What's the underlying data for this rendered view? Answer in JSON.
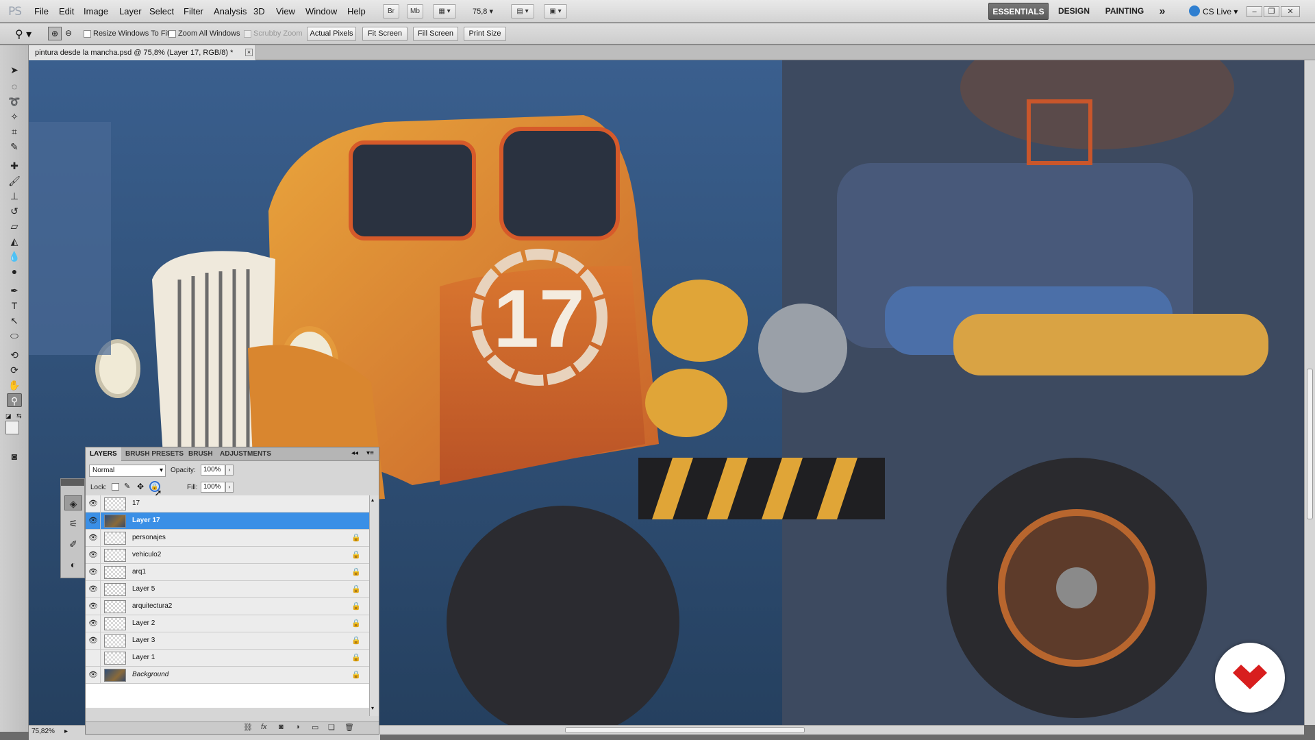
{
  "app": {
    "logo": "PS"
  },
  "menubar": {
    "items": [
      "File",
      "Edit",
      "Image",
      "Layer",
      "Select",
      "Filter",
      "Analysis",
      "3D",
      "View",
      "Window",
      "Help"
    ],
    "bridge_btn": "Br",
    "minibridge_btn": "Mb",
    "zoom_value": "75,8",
    "workspaces": [
      "ESSENTIALS",
      "DESIGN",
      "PAINTING"
    ],
    "more": "»",
    "cs_live": "CS Live"
  },
  "options": {
    "resize_windows": "Resize Windows To Fit",
    "zoom_all": "Zoom All Windows",
    "scrubby_zoom": "Scrubby Zoom",
    "actual_pixels": "Actual Pixels",
    "fit_screen": "Fit Screen",
    "fill_screen": "Fill Screen",
    "print_size": "Print Size"
  },
  "document": {
    "tab_title": "pintura desde la mancha.psd @ 75,8% (Layer 17, RGB/8) *",
    "zoom_status": "75,82%",
    "artwork_text": "17"
  },
  "layers_panel": {
    "tabs": [
      "LAYERS",
      "BRUSH PRESETS",
      "BRUSH",
      "ADJUSTMENTS"
    ],
    "blend_mode": "Normal",
    "opacity_label": "Opacity:",
    "opacity_value": "100%",
    "lock_label": "Lock:",
    "fill_label": "Fill:",
    "fill_value": "100%",
    "layers": [
      {
        "name": "17",
        "visible": true,
        "locked": false,
        "selected": false
      },
      {
        "name": "Layer 17",
        "visible": true,
        "locked": false,
        "selected": true
      },
      {
        "name": "personajes",
        "visible": true,
        "locked": true,
        "selected": false
      },
      {
        "name": "vehiculo2",
        "visible": true,
        "locked": true,
        "selected": false
      },
      {
        "name": "arq1",
        "visible": true,
        "locked": true,
        "selected": false
      },
      {
        "name": "Layer 5",
        "visible": true,
        "locked": true,
        "selected": false
      },
      {
        "name": "arquitectura2",
        "visible": true,
        "locked": true,
        "selected": false
      },
      {
        "name": "Layer 2",
        "visible": true,
        "locked": true,
        "selected": false
      },
      {
        "name": "Layer 3",
        "visible": true,
        "locked": true,
        "selected": false
      },
      {
        "name": "Layer 1",
        "visible": false,
        "locked": true,
        "selected": false
      },
      {
        "name": "Background",
        "visible": true,
        "locked": true,
        "selected": false
      }
    ]
  },
  "colors": {
    "selection": "#3a8fe6",
    "truck_orange": "#d98a2b",
    "badge_red": "#d81e1e"
  }
}
